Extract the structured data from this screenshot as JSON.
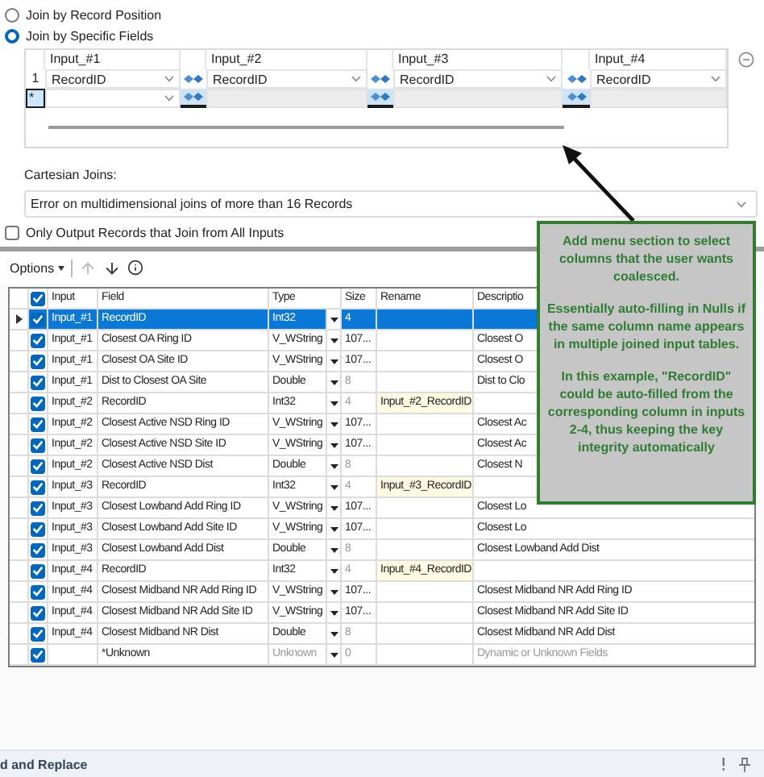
{
  "join_mode": [
    {
      "label": "Join by Record Position",
      "selected": false
    },
    {
      "label": "Join by Specific Fields",
      "selected": true
    }
  ],
  "join_fields": {
    "columns": [
      "Input_#1",
      "Input_#2",
      "Input_#3",
      "Input_#4"
    ],
    "rows": [
      {
        "number": "1",
        "fields": [
          "RecordID",
          "RecordID",
          "RecordID",
          "RecordID"
        ]
      }
    ],
    "new_row": {
      "marker": "*",
      "fields": [
        {
          "disabled": false
        },
        {
          "disabled": true
        },
        {
          "disabled": true
        },
        {
          "disabled": true
        }
      ]
    }
  },
  "cartesian_joins": {
    "label": "Cartesian Joins:",
    "value": "Error on multidimensional joins of more than 16 Records"
  },
  "only_output_all": {
    "label": "Only Output Records that Join from All Inputs",
    "checked": false
  },
  "toolbar": {
    "options": "Options"
  },
  "select_table": {
    "columns": [
      "Input",
      "Field",
      "Type",
      "Size",
      "Rename",
      "Descriptio"
    ],
    "all_checked": true,
    "rows": [
      {
        "kind": "field",
        "selected": true,
        "checked": true,
        "input": "Input_#1",
        "field": "RecordID",
        "type": "Int32",
        "size": "4"
      },
      {
        "kind": "field",
        "selected": false,
        "checked": true,
        "input": "Input_#1",
        "field": "Closest OA Ring ID",
        "type": "V_WString",
        "size": "107...",
        "description": "Closest O"
      },
      {
        "kind": "field",
        "selected": false,
        "checked": true,
        "input": "Input_#1",
        "field": "Closest OA Site ID",
        "type": "V_WString",
        "size": "107...",
        "description": "Closest O"
      },
      {
        "kind": "field",
        "selected": false,
        "checked": true,
        "input": "Input_#1",
        "field": "Dist to Closest OA Site",
        "type": "Double",
        "size": "8",
        "description": "Dist to Clo"
      },
      {
        "kind": "field",
        "selected": false,
        "checked": true,
        "input": "Input_#2",
        "field": "RecordID",
        "type": "Int32",
        "size": "4",
        "rename": "Input_#2_RecordID"
      },
      {
        "kind": "field",
        "selected": false,
        "checked": true,
        "input": "Input_#2",
        "field": "Closest Active NSD Ring ID",
        "type": "V_WString",
        "size": "107...",
        "description": "Closest Ac"
      },
      {
        "kind": "field",
        "selected": false,
        "checked": true,
        "input": "Input_#2",
        "field": "Closest Active NSD Site ID",
        "type": "V_WString",
        "size": "107...",
        "description": "Closest Ac"
      },
      {
        "kind": "field",
        "selected": false,
        "checked": true,
        "input": "Input_#2",
        "field": "Closest Active NSD Dist",
        "type": "Double",
        "size": "8",
        "description": "Closest N"
      },
      {
        "kind": "field",
        "selected": false,
        "checked": true,
        "input": "Input_#3",
        "field": "RecordID",
        "type": "Int32",
        "size": "4",
        "rename": "Input_#3_RecordID"
      },
      {
        "kind": "field",
        "selected": false,
        "checked": true,
        "input": "Input_#3",
        "field": "Closest Lowband Add Ring ID",
        "type": "V_WString",
        "size": "107...",
        "description": "Closest Lo"
      },
      {
        "kind": "field",
        "selected": false,
        "checked": true,
        "input": "Input_#3",
        "field": "Closest Lowband Add Site ID",
        "type": "V_WString",
        "size": "107...",
        "description": "Closest Lo"
      },
      {
        "kind": "field",
        "selected": false,
        "checked": true,
        "input": "Input_#3",
        "field": "Closest Lowband Add Dist",
        "type": "Double",
        "size": "8",
        "description": "Closest Lowband Add Dist"
      },
      {
        "kind": "field",
        "selected": false,
        "checked": true,
        "input": "Input_#4",
        "field": "RecordID",
        "type": "Int32",
        "size": "4",
        "rename": "Input_#4_RecordID"
      },
      {
        "kind": "field",
        "selected": false,
        "checked": true,
        "input": "Input_#4",
        "field": "Closest Midband NR Add Ring ID",
        "type": "V_WString",
        "size": "107...",
        "description": "Closest Midband NR Add Ring ID"
      },
      {
        "kind": "field",
        "selected": false,
        "checked": true,
        "input": "Input_#4",
        "field": "Closest Midband NR Add Site ID",
        "type": "V_WString",
        "size": "107...",
        "description": "Closest Midband NR Add Site ID"
      },
      {
        "kind": "field",
        "selected": false,
        "checked": true,
        "input": "Input_#4",
        "field": "Closest Midband NR Dist",
        "type": "Double",
        "size": "8",
        "description": "Closest Midband NR Add Dist"
      },
      {
        "kind": "unknown",
        "selected": false,
        "checked": true,
        "field": "*Unknown",
        "type": "Unknown",
        "size": "0",
        "description": "Dynamic or Unknown Fields"
      }
    ]
  },
  "callout": {
    "paragraphs": [
      "Add menu section to select columns that the user wants coalesced.",
      "Essentially auto-filling in Nulls if the same column name appears in multiple joined input tables.",
      "In this example, \"RecordID\" could be auto-filled from the corresponding column in inputs 2-4, thus keeping the key integrity automatically"
    ]
  },
  "footer": {
    "text": "d and Replace"
  }
}
